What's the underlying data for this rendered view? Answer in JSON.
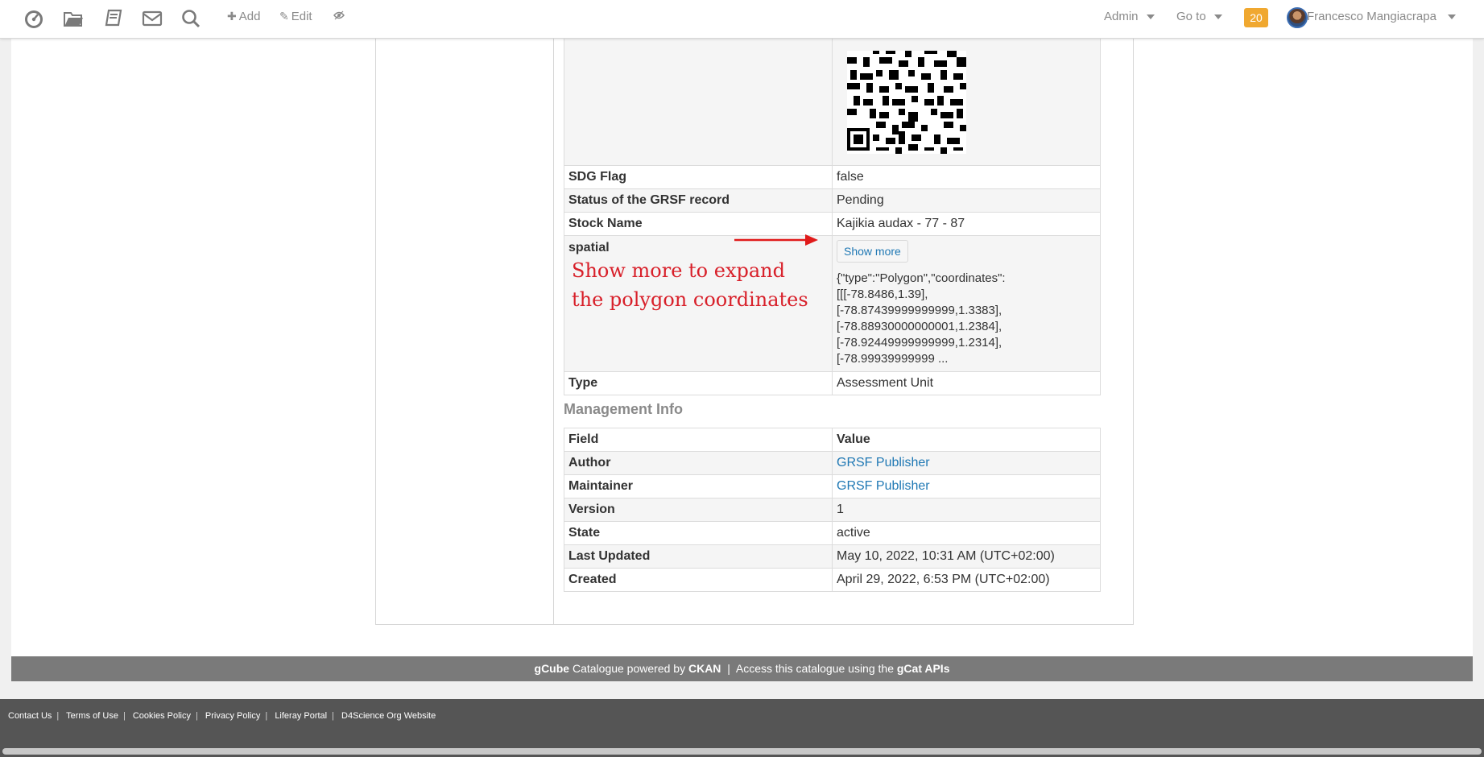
{
  "topbar": {
    "icons": [
      "dashboard-icon",
      "folder-icon",
      "books-icon",
      "mail-icon",
      "search-icon"
    ],
    "add_label": "Add",
    "edit_label": "Edit",
    "admin_label": "Admin",
    "goto_label": "Go to",
    "notifications": "20",
    "user_name": "Francesco Mangiacrapa"
  },
  "record_rows": [
    {
      "key": "SDG Flag",
      "value": "false"
    },
    {
      "key": "Status of the GRSF record",
      "value": "Pending"
    },
    {
      "key": "Stock Name",
      "value": "Kajikia audax - 77 - 87"
    },
    {
      "key": "spatial",
      "value": ""
    },
    {
      "key": "Type",
      "value": "Assessment Unit"
    }
  ],
  "spatial": {
    "button_label": "Show more",
    "lines": [
      "{\"type\":\"Polygon\",\"coordinates\":",
      "[[[-78.8486,1.39],",
      "[-78.87439999999999,1.3383],",
      "[-78.88930000000001,1.2384],",
      "[-78.92449999999999,1.2314],",
      "[-78.99939999999 ..."
    ]
  },
  "annotation": {
    "line1": "Show more to expand",
    "line2": "the polygon coordinates"
  },
  "management": {
    "title": "Management Info",
    "header": {
      "key": "Field",
      "value": "Value"
    },
    "rows": [
      {
        "key": "Author",
        "value": "GRSF Publisher"
      },
      {
        "key": "Maintainer",
        "value": "GRSF Publisher"
      },
      {
        "key": "Version",
        "value": "1"
      },
      {
        "key": "State",
        "value": "active"
      },
      {
        "key": "Last Updated",
        "value": "May 10, 2022, 10:31 AM (UTC+02:00)"
      },
      {
        "key": "Created",
        "value": "April 29, 2022, 6:53 PM (UTC+02:00)"
      }
    ]
  },
  "footer": {
    "gcube": "gCube",
    "catalogue_text": "Catalogue powered by",
    "ckan": "CKAN",
    "separator": "|",
    "access_text": "Access this catalogue using the",
    "gcat": "gCat APIs"
  },
  "bottom_links": [
    "Contact Us",
    "Terms of Use",
    "Cookies Policy",
    "Privacy Policy",
    "Liferay Portal",
    "D4Science Org Website"
  ],
  "colors": {
    "link": "#1f78b4",
    "annotation": "#d8202a",
    "badge": "#f0a830"
  }
}
